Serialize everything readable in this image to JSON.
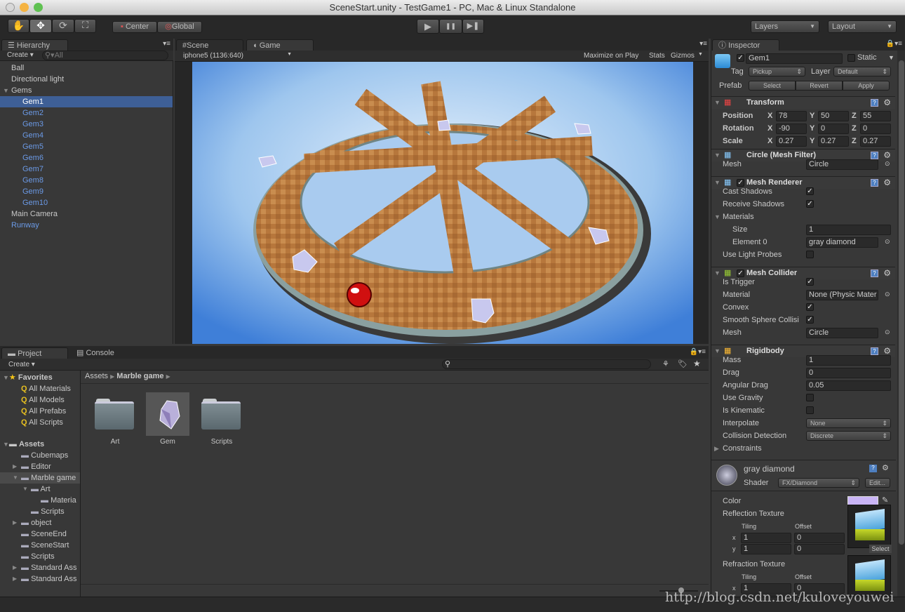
{
  "window": {
    "title": "SceneStart.unity - TestGame1 - PC, Mac & Linux Standalone"
  },
  "toolbar": {
    "tools": [
      "hand-icon",
      "move-icon",
      "rotate-icon",
      "scale-icon"
    ],
    "pivot": "Center",
    "space": "Global",
    "play": "▶",
    "pause": "❚❚",
    "step": "▶❚",
    "layers": "Layers",
    "layout": "Layout"
  },
  "hierarchy": {
    "tab": "Hierarchy",
    "create": "Create",
    "search_placeholder": "All",
    "items": [
      {
        "label": "Ball",
        "indent": 0
      },
      {
        "label": "Directional light",
        "indent": 0
      },
      {
        "label": "Gems",
        "indent": 0,
        "expanded": true
      },
      {
        "label": "Gem1",
        "indent": 1,
        "selected": true,
        "prefab": true
      },
      {
        "label": "Gem2",
        "indent": 1,
        "prefab": true
      },
      {
        "label": "Gem3",
        "indent": 1,
        "prefab": true
      },
      {
        "label": "Gem4",
        "indent": 1,
        "prefab": true
      },
      {
        "label": "Gem5",
        "indent": 1,
        "prefab": true
      },
      {
        "label": "Gem6",
        "indent": 1,
        "prefab": true
      },
      {
        "label": "Gem7",
        "indent": 1,
        "prefab": true
      },
      {
        "label": "Gem8",
        "indent": 1,
        "prefab": true
      },
      {
        "label": "Gem9",
        "indent": 1,
        "prefab": true
      },
      {
        "label": "Gem10",
        "indent": 1,
        "prefab": true
      },
      {
        "label": "Main Camera",
        "indent": 0
      },
      {
        "label": "Runway",
        "indent": 0,
        "prefab": true
      }
    ]
  },
  "game": {
    "tabs": [
      "Scene",
      "Game"
    ],
    "active_tab": "Game",
    "resolution": "iphone5 (1136:640)",
    "maximize": "Maximize on Play",
    "stats": "Stats",
    "gizmos": "Gizmos"
  },
  "project": {
    "tabs": [
      "Project",
      "Console"
    ],
    "create": "Create",
    "favorites_label": "Favorites",
    "favorites": [
      "All Materials",
      "All Models",
      "All Prefabs",
      "All Scripts"
    ],
    "assets_label": "Assets",
    "tree": [
      {
        "label": "Cubemaps",
        "indent": 1
      },
      {
        "label": "Editor",
        "indent": 1,
        "arrow": "▶"
      },
      {
        "label": "Marble game",
        "indent": 1,
        "arrow": "▼",
        "selected": true
      },
      {
        "label": "Art",
        "indent": 2,
        "arrow": "▼"
      },
      {
        "label": "Materia",
        "indent": 3
      },
      {
        "label": "Scripts",
        "indent": 2
      },
      {
        "label": "object",
        "indent": 1,
        "arrow": "▶"
      },
      {
        "label": "SceneEnd",
        "indent": 1
      },
      {
        "label": "SceneStart",
        "indent": 1
      },
      {
        "label": "Scripts",
        "indent": 1
      },
      {
        "label": "Standard Ass",
        "indent": 1,
        "arrow": "▶"
      },
      {
        "label": "Standard Ass",
        "indent": 1,
        "arrow": "▶"
      }
    ],
    "breadcrumb": [
      "Assets",
      "Marble game"
    ],
    "assets": [
      {
        "label": "Art",
        "type": "folder"
      },
      {
        "label": "Gem",
        "type": "prefab"
      },
      {
        "label": "Scripts",
        "type": "folder"
      }
    ]
  },
  "inspector": {
    "tab": "Inspector",
    "name": "Gem1",
    "active": true,
    "static_label": "Static",
    "tag_label": "Tag",
    "tag": "Pickup",
    "layer_label": "Layer",
    "layer": "Default",
    "prefab_label": "Prefab",
    "prefab_buttons": [
      "Select",
      "Revert",
      "Apply"
    ],
    "transform": {
      "title": "Transform",
      "rows": [
        {
          "label": "Position",
          "x": "78",
          "y": "50",
          "z": "55"
        },
        {
          "label": "Rotation",
          "x": "-90",
          "y": "0",
          "z": "0"
        },
        {
          "label": "Scale",
          "x": "0.27",
          "y": "0.27",
          "z": "0.27"
        }
      ]
    },
    "mesh_filter": {
      "title": "Circle (Mesh Filter)",
      "mesh_label": "Mesh",
      "mesh": "Circle"
    },
    "mesh_renderer": {
      "title": "Mesh Renderer",
      "cast_shadows": "Cast Shadows",
      "receive_shadows": "Receive Shadows",
      "materials": "Materials",
      "size_label": "Size",
      "size": "1",
      "element0_label": "Element 0",
      "element0": "gray diamond",
      "light_probes": "Use Light Probes"
    },
    "mesh_collider": {
      "title": "Mesh Collider",
      "is_trigger": "Is Trigger",
      "material_label": "Material",
      "material": "None (Physic Mater",
      "convex": "Convex",
      "smooth": "Smooth Sphere Collisi",
      "mesh_label": "Mesh",
      "mesh": "Circle"
    },
    "rigidbody": {
      "title": "Rigidbody",
      "mass_label": "Mass",
      "mass": "1",
      "drag_label": "Drag",
      "drag": "0",
      "angular_label": "Angular Drag",
      "angular": "0.05",
      "gravity": "Use Gravity",
      "kinematic": "Is Kinematic",
      "interpolate_label": "Interpolate",
      "interpolate": "None",
      "collision_label": "Collision Detection",
      "collision": "Discrete",
      "constraints": "Constraints"
    },
    "material": {
      "name": "gray diamond",
      "shader_label": "Shader",
      "shader": "FX/Diamond",
      "edit": "Edit...",
      "color_label": "Color",
      "color": "#c9b4f5",
      "reflection": "Reflection Texture",
      "refraction": "Refraction Texture",
      "tiling": "Tiling",
      "offset": "Offset",
      "x_label": "x",
      "y_label": "y",
      "tx": "1",
      "ty": "1",
      "ox": "0",
      "oy": "0",
      "select": "Select"
    }
  },
  "watermark": "http://blog.csdn.net/kuloveyouwei"
}
